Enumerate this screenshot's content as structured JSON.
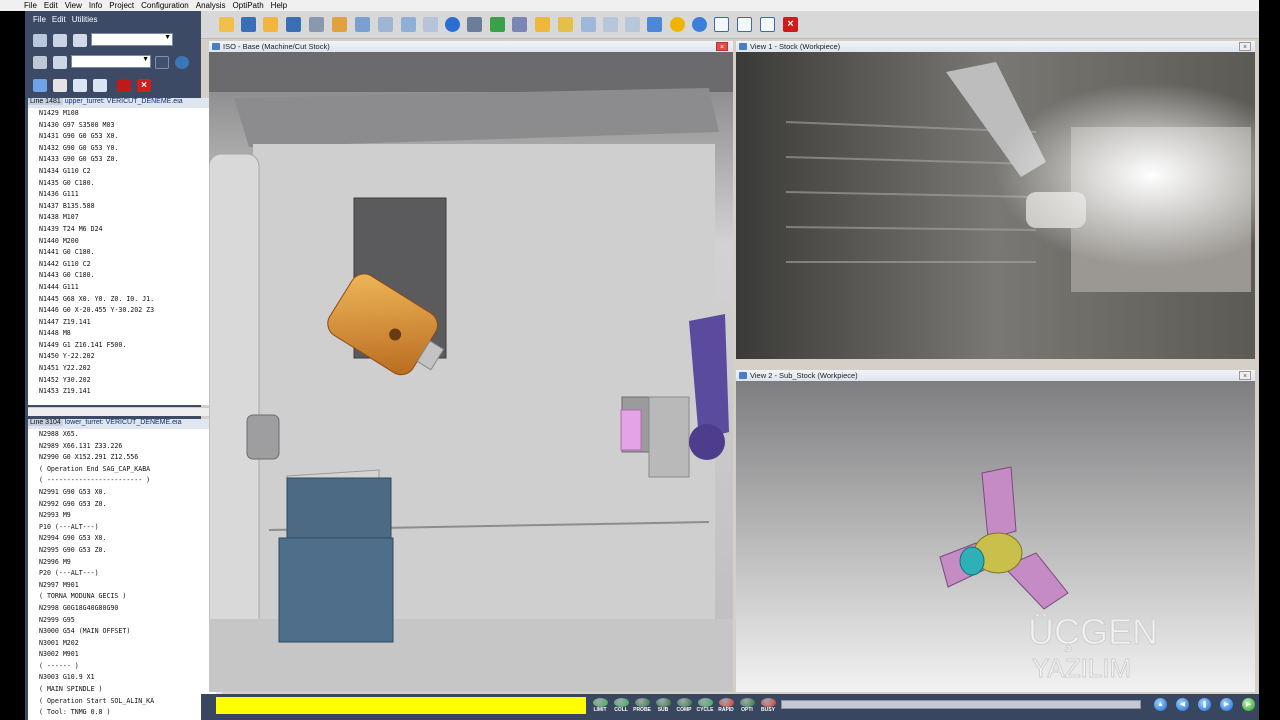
{
  "menubar": [
    "File",
    "Edit",
    "View",
    "Info",
    "Project",
    "Configuration",
    "Analysis",
    "OptiPath",
    "Help"
  ],
  "left_menu": [
    "File",
    "Edit",
    "Utilities"
  ],
  "upper_panel": {
    "line_label": "Line 1481",
    "file_label": "upper_turret: VERICUT_DENEME.eia",
    "lines": [
      "N1429 M108",
      "N1430 G97 S3500 M03",
      "N1431 G90 G0 G53 X0.",
      "N1432 G90 G0 G53 Y0.",
      "N1433 G90 G0 G53 Z0.",
      "N1434 G110 C2",
      "N1435 G0 C180.",
      "N1436 G111",
      "N1437 B135.588",
      "N1438 M107",
      "N1439 T24 M6 D24",
      "N1440 M200",
      "N1441 G0 C180.",
      "N1442 G110 C2",
      "N1443 G0 C180.",
      "N1444 G111",
      "N1445 G68 X0. Y0. Z0. I0. J1.",
      "N1446 G0 X-20.455 Y-30.202 Z3",
      "N1447 Z19.141",
      "N1448 M8",
      "N1449 G1 Z16.141 F500.",
      "N1450 Y-22.202",
      "N1451 Y22.202",
      "N1452 Y30.202",
      "N1453 Z19.141"
    ],
    "current_index": 12
  },
  "lower_panel": {
    "line_label": "Line 3104",
    "file_label": "lower_turret: VERICUT_DENEME.eia",
    "lines": [
      "N2988 X65.",
      "N2989 X66.131 Z33.226",
      "N2990 G0 X152.291 Z12.556",
      "( Operation End SAG_CAP_KABA",
      "( ------------------------ )",
      "N2991 G90 G53 X0.",
      "N2992 G90 G53 Z0.",
      "N2993 M9",
      "P10 (---ALT---)",
      "N2994 G90 G53 X0.",
      "N2995 G90 G53 Z0.",
      "N2996 M9",
      "P20 (---ALT---)",
      "N2997 M901",
      "( TORNA MODUNA GECIS )",
      "N2998 G0G18G40G80G90",
      "N2999 G95",
      "N3000 G54 (MAIN OFFSET)",
      "N3001 M202",
      "N3002 M901",
      "( ------ )",
      "N3003 G10.9 X1",
      "( MAIN SPINDLE )",
      "( Operation Start SOL_ALIN_KA",
      "( Tool: TNMG 0.8 )"
    ],
    "breakpoint_index": 12
  },
  "views": {
    "iso_title": "ISO - Base (Machine/Cut Stock)",
    "view1_title": "View 1 - Stock (Workpiece)",
    "view2_title": "View 2 - Sub_Stock (Workpiece)"
  },
  "watermark": {
    "line1": "ÜÇGEN",
    "line2": "YAZILIM"
  },
  "status_lights": [
    {
      "label": "LIMIT",
      "color": "#3bb04a"
    },
    {
      "label": "COLL",
      "color": "#3bb04a"
    },
    {
      "label": "PROBE",
      "color": "#2e7a38"
    },
    {
      "label": "SUB",
      "color": "#2e7a38"
    },
    {
      "label": "COMP",
      "color": "#2e7a38"
    },
    {
      "label": "CYCLE",
      "color": "#3bb04a"
    },
    {
      "label": "RAPID",
      "color": "#e03a2a"
    },
    {
      "label": "OPTI",
      "color": "#2e7a38"
    },
    {
      "label": "BUSY",
      "color": "#e03a2a"
    }
  ],
  "progress": 1.0,
  "colors": {
    "accent": "#3c4a66",
    "progress": "#ffff00"
  }
}
